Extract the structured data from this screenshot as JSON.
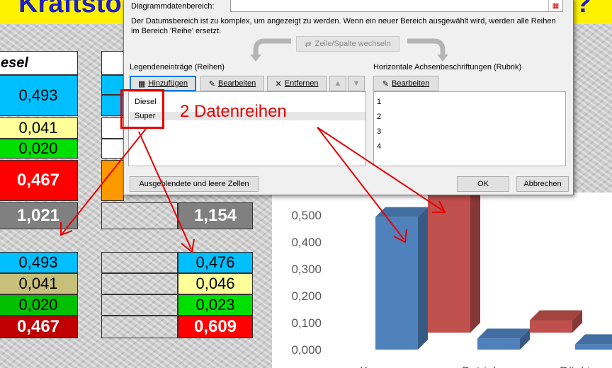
{
  "headline": {
    "text": "Kraftsto",
    "suffix": "?"
  },
  "left_table": {
    "header": "esel",
    "values": [
      "0,493",
      "0,041",
      "0,020",
      "0,467"
    ],
    "total": "1,021"
  },
  "right_table_total": "1,154",
  "bottom_left": [
    "0,493",
    "0,041",
    "0,020",
    "0,467"
  ],
  "bottom_right": [
    "0,476",
    "0,046",
    "0,023",
    "0,609"
  ],
  "dialog": {
    "range_label": "Diagrammdatenbereich:",
    "message": "Der Datumsbereich ist zu komplex, um angezeigt zu werden. Wenn ein neuer Bereich ausgewählt wird, werden alle Reihen im Bereich 'Reihe' ersetzt.",
    "switch_label": "Zeile/Spalte wechseln",
    "legend_title": "Legendeneinträge (Reihen)",
    "axis_title": "Horizontale Achsenbeschriftungen (Rubrik)",
    "add_label": "Hinzufügen",
    "edit_label": "Bearbeiten",
    "remove_label": "Entfernen",
    "axis_edit_label": "Bearbeiten",
    "series": [
      "Diesel",
      "Super"
    ],
    "categories": [
      "1",
      "2",
      "3",
      "4"
    ],
    "hidden_cells_label": "Ausgeblendete und leere Zellen",
    "ok_label": "OK",
    "cancel_label": "Abbrechen"
  },
  "annotation": "2 Datenreihen",
  "chart_data": {
    "type": "bar",
    "yticks": [
      "0,500",
      "0,400",
      "0,300",
      "0,200",
      "0,100",
      "0,000"
    ],
    "ylim": [
      0,
      0.5
    ],
    "series": [
      {
        "values": [
          0.493,
          0.041,
          0.02
        ]
      },
      {
        "values": [
          0.609,
          0.046,
          0.023
        ]
      }
    ],
    "colors": [
      "#4f81bd",
      "#c0504d"
    ],
    "category_fragments": [
      "K",
      "Betrieb",
      "Rückt"
    ]
  },
  "colors": {
    "annotation": "#e60000",
    "headline": "#1f1fc8"
  }
}
